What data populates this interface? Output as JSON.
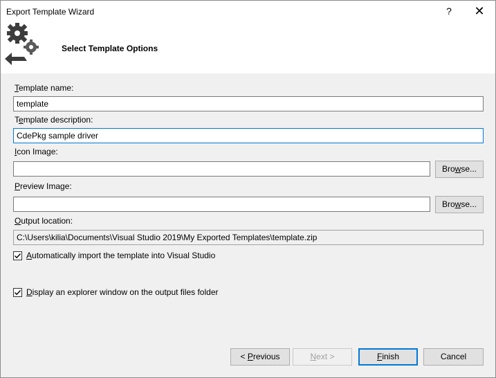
{
  "window": {
    "title": "Export Template Wizard",
    "help_glyph": "?",
    "close_glyph": "✕"
  },
  "header": {
    "title": "Select Template Options",
    "icon": "gears-export-icon"
  },
  "fields": {
    "template_name": {
      "label_u": "T",
      "label_rest": "emplate name:",
      "value": "template"
    },
    "template_description": {
      "label_pre": "T",
      "label_u": "e",
      "label_rest": "mplate description:",
      "value": "CdePkg sample driver"
    },
    "icon_image": {
      "label_u": "I",
      "label_rest": "con Image:",
      "value": "",
      "browse_u": "w",
      "browse_pre": "Bro",
      "browse_rest": "se..."
    },
    "preview_image": {
      "label_u": "P",
      "label_rest": "review Image:",
      "value": "",
      "browse_pre": "Bro",
      "browse_u": "w",
      "browse_rest": "se..."
    },
    "output_location": {
      "label_u": "O",
      "label_rest": "utput location:",
      "value": "C:\\Users\\kilia\\Documents\\Visual Studio 2019\\My Exported Templates\\template.zip"
    }
  },
  "options": {
    "auto_import": {
      "label_u": "A",
      "label_rest": "utomatically import the template into Visual Studio",
      "checked": true
    },
    "explorer_window": {
      "label_u": "D",
      "label_rest": "isplay an explorer window on the output files folder",
      "checked": true
    }
  },
  "buttons": {
    "previous": {
      "pre": "< ",
      "u": "P",
      "rest": "revious"
    },
    "next": {
      "u": "N",
      "rest": "ext >"
    },
    "finish": {
      "u": "F",
      "rest": "inish"
    },
    "cancel": {
      "label": "Cancel"
    }
  }
}
